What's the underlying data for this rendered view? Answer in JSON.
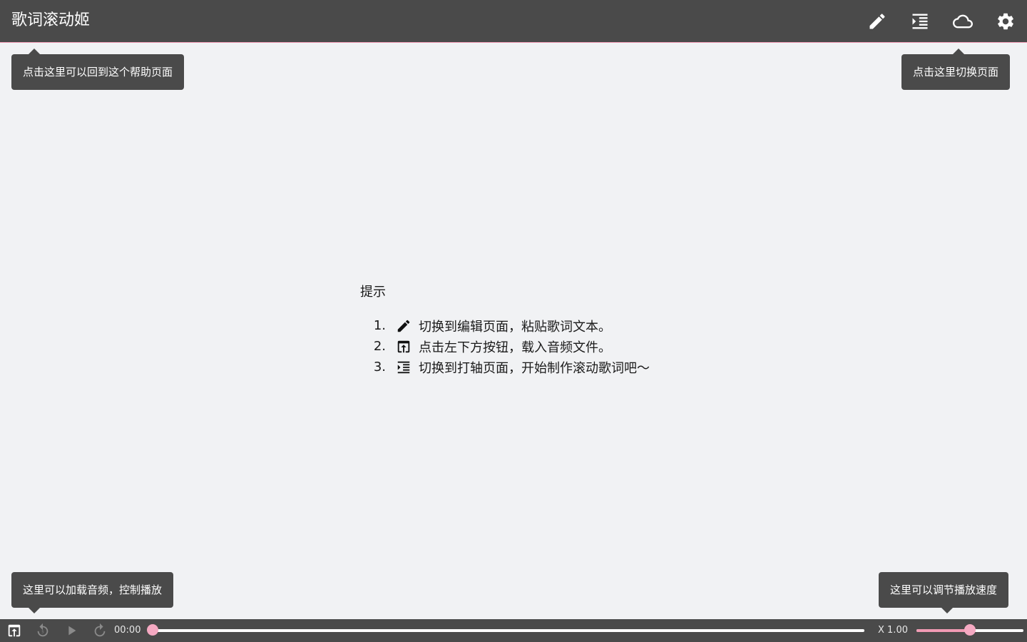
{
  "app": {
    "title": "歌词滚动姬"
  },
  "header": {
    "buttons": [
      {
        "name": "edit-page",
        "icon": "pencil-icon"
      },
      {
        "name": "tag-page",
        "icon": "format-indent-icon"
      },
      {
        "name": "cloud-page",
        "icon": "cloud-icon"
      },
      {
        "name": "settings-page",
        "icon": "gear-icon"
      }
    ]
  },
  "tooltips": {
    "help": "点击这里可以回到这个帮助页面",
    "switch": "点击这里切换页面",
    "audio": "这里可以加载音频，控制播放",
    "speed": "这里可以调节播放速度"
  },
  "tips": {
    "title": "提示",
    "items": [
      {
        "num": "1.",
        "icon": "pencil-icon",
        "text": "切换到编辑页面，粘贴歌词文本。"
      },
      {
        "num": "2.",
        "icon": "upload-box-icon",
        "text": "点击左下方按钮，载入音频文件。"
      },
      {
        "num": "3.",
        "icon": "format-indent-icon",
        "text": "切换到打轴页面，开始制作滚动歌词吧～"
      }
    ]
  },
  "player": {
    "time": "00:00",
    "progress": 0,
    "speed_label": "X 1.00",
    "speed_fraction": 0.5
  },
  "colors": {
    "bar": "#4a4a4a",
    "accent": "#f19bb4",
    "background": "#f1f2f4"
  }
}
